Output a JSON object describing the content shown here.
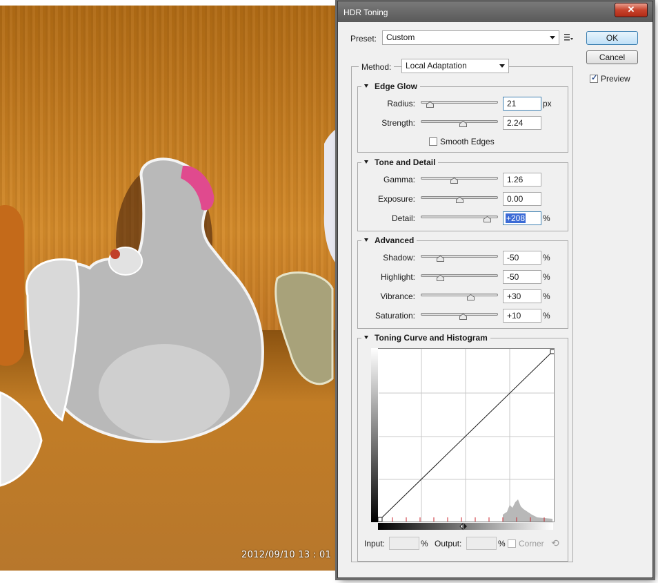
{
  "photo": {
    "timestamp": "2012/09/10  13 : 01"
  },
  "dialog": {
    "title": "HDR Toning",
    "close_glyph": "✕",
    "preset_label": "Preset:",
    "preset_value": "Custom",
    "ok_label": "OK",
    "cancel_label": "Cancel",
    "preview_label": "Preview",
    "preview_checked": true,
    "method_label": "Method:",
    "method_value": "Local Adaptation"
  },
  "edge_glow": {
    "title": "Edge Glow",
    "radius": {
      "label": "Radius:",
      "value": "21",
      "unit": "px",
      "fraction": 0.12
    },
    "strength": {
      "label": "Strength:",
      "value": "2.24",
      "fraction": 0.55
    },
    "smooth_edges_label": "Smooth Edges",
    "smooth_edges_checked": false
  },
  "tone_detail": {
    "title": "Tone and Detail",
    "gamma": {
      "label": "Gamma:",
      "value": "1.26",
      "fraction": 0.43
    },
    "exposure": {
      "label": "Exposure:",
      "value": "0.00",
      "fraction": 0.5
    },
    "detail": {
      "label": "Detail:",
      "value": "+208",
      "unit": "%",
      "fraction": 0.86
    }
  },
  "advanced": {
    "title": "Advanced",
    "shadow": {
      "label": "Shadow:",
      "value": "-50",
      "unit": "%",
      "fraction": 0.25
    },
    "highlight": {
      "label": "Highlight:",
      "value": "-50",
      "unit": "%",
      "fraction": 0.25
    },
    "vibrance": {
      "label": "Vibrance:",
      "value": "+30",
      "unit": "%",
      "fraction": 0.65
    },
    "saturation": {
      "label": "Saturation:",
      "value": "+10",
      "unit": "%",
      "fraction": 0.55
    }
  },
  "toning_curve": {
    "title": "Toning Curve and Histogram",
    "input_label": "Input:",
    "input_unit": "%",
    "output_label": "Output:",
    "output_unit": "%",
    "corner_label": "Corner",
    "corner_checked": false,
    "reset_icon": "⟲"
  },
  "colors": {
    "title_bar": "#5f5f5f",
    "close_button": "#c7432c",
    "default_button_border": "#3c7fb1",
    "selection": "#3b6bd6"
  }
}
